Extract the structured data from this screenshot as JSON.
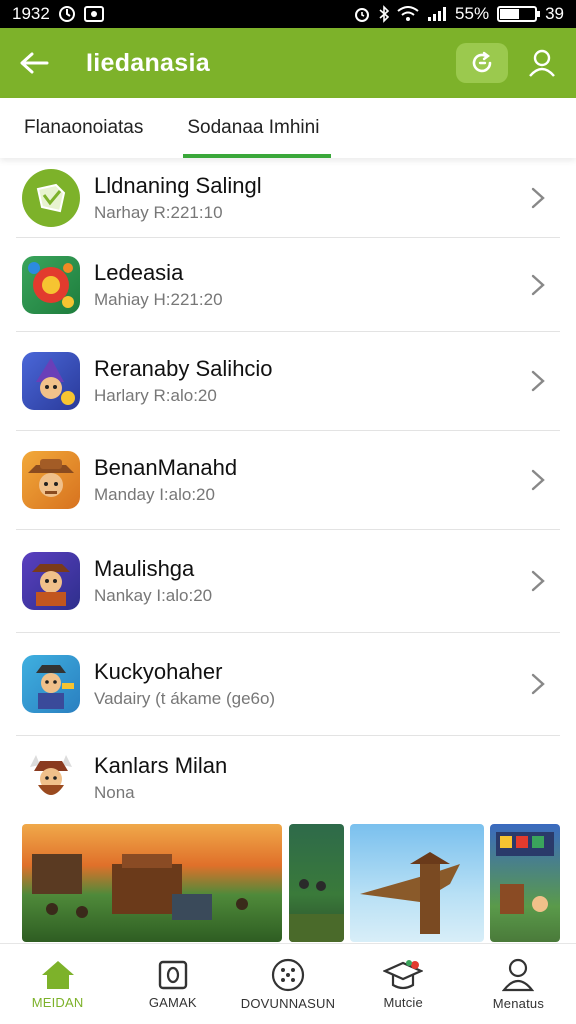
{
  "status_bar": {
    "time": "1932",
    "battery": "55%",
    "battery_level": 0.55,
    "extra": "39"
  },
  "app_bar": {
    "title": "Iiedanasia",
    "accent": "#7db22a"
  },
  "tabs": [
    {
      "label": "Flanaonoiatas",
      "active": false
    },
    {
      "label": "Sodanaa Imhini",
      "active": true
    }
  ],
  "items": [
    {
      "title": "Lldnaning Salingl",
      "subtitle": "Narhay R:221:10",
      "icon": "shield-leaf-icon"
    },
    {
      "title": "Ledeasia",
      "subtitle": "Mahiay H:221:20",
      "icon": "game-icon-fruit"
    },
    {
      "title": "Reranaby Salihcio",
      "subtitle": "Harlary R:alo:20",
      "icon": "game-icon-wizard"
    },
    {
      "title": "BenanManahd",
      "subtitle": "Manday I:alo:20",
      "icon": "game-icon-cowboy"
    },
    {
      "title": "Maulishga",
      "subtitle": "Nankay I:alo:20",
      "icon": "game-icon-warrior"
    },
    {
      "title": "Kuckyohaher",
      "subtitle": "Vadairy (t ákame (ge6o)",
      "icon": "game-icon-builder"
    },
    {
      "title": "Kanlars Milan",
      "subtitle": "Nona",
      "icon": "game-icon-viking"
    }
  ],
  "bottom_nav": [
    {
      "label": "MEIDAN",
      "icon": "home-icon",
      "active": true
    },
    {
      "label": "GAMAK",
      "icon": "square-icon",
      "active": false
    },
    {
      "label": "DOVUNNASUN",
      "icon": "dots-circle-icon",
      "active": false
    },
    {
      "label": "Mutcie",
      "icon": "graduation-cap-icon",
      "active": false
    },
    {
      "label": "Menatus",
      "icon": "person-icon",
      "active": false
    }
  ]
}
